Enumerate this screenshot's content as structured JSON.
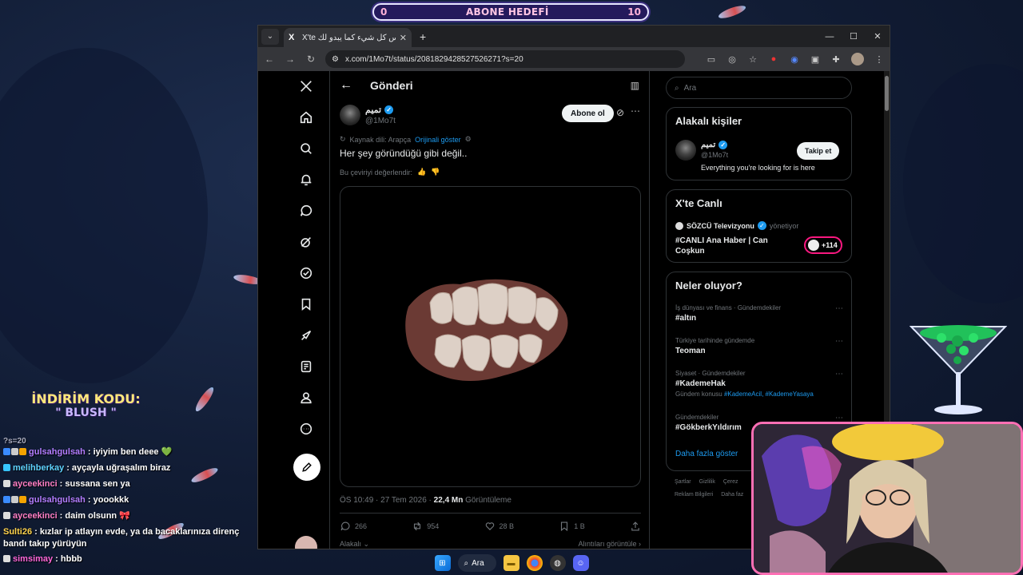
{
  "overlay": {
    "goal": {
      "start": "0",
      "title": "ABONE HEDEFİ",
      "end": "10"
    },
    "promo": {
      "line1": "İNDİRİM KODU:",
      "line2": "\" BLUSH \""
    },
    "chat_partial": "?s=20",
    "chat": [
      {
        "user": "gulsahgulsah",
        "user_color": "#b37dff",
        "message": ": iyiyim ben deee 💚",
        "badges": 3
      },
      {
        "user": "melihberkay",
        "user_color": "#5fd3ff",
        "message": ": ayçayla uğraşalım biraz",
        "badges": 1
      },
      {
        "user": "ayceekinci",
        "user_color": "#ff7fc6",
        "message": ": sussana sen ya",
        "badges": 1
      },
      {
        "user": "gulsahgulsah",
        "user_color": "#b37dff",
        "message": ": yoookkk",
        "badges": 3
      },
      {
        "user": "ayceekinci",
        "user_color": "#ff7fc6",
        "message": ": daim olsunn 🎀",
        "badges": 1
      },
      {
        "user": "Sulti26",
        "user_color": "#ffd34d",
        "message": ": kızlar ip atlayın evde, ya da bacaklarınıza direnç bandı takıp yürüyün",
        "badges": 0
      },
      {
        "user": "simsimay",
        "user_color": "#ff66d9",
        "message": ": hbbb",
        "badges": 1
      }
    ]
  },
  "browser": {
    "tab": {
      "favicon": "X",
      "title": "X'te تميم: \"ليس كل شيء كما يبدو لك\""
    },
    "url": "x.com/1Mo7t/status/2081829428527526271?s=20",
    "window_controls": [
      "minimize-icon",
      "maximize-icon",
      "close-icon"
    ]
  },
  "post": {
    "header_title": "Gönderi",
    "author_name": "تميم",
    "author_handle": "@1Mo7t",
    "subscribe_label": "Abone ol",
    "translation_source": "Kaynak dili: Arapça",
    "show_original": "Orijinali göster",
    "text": "Her şey göründüğü gibi değil..",
    "rate_translation": "Bu çeviriyi değerlendir:",
    "timestamp": "ÖS 10:49 · 27 Tem 2026 ·",
    "views_count": "22,4 Mn",
    "views_label": "Görüntüleme",
    "replies": "266",
    "reposts": "954",
    "likes": "28 B",
    "bookmarks": "1 B",
    "sort_label": "Alakalı",
    "quotes_label": "Alıntıları görüntüle"
  },
  "sidebar": {
    "search_placeholder": "Ara",
    "relevant": {
      "title": "Alakalı kişiler",
      "name": "تميم",
      "handle": "@1Mo7t",
      "bio": "Everything you're looking for is here",
      "follow_label": "Takip et"
    },
    "live": {
      "title": "X'te Canlı",
      "host": "SÖZCÜ Televizyonu",
      "host_role": "yönetiyor",
      "stream_title": "#CANLI Ana Haber | Can Coşkun",
      "listeners": "+114"
    },
    "trends": {
      "title": "Neler oluyor?",
      "items": [
        {
          "category": "İş dünyası ve finans · Gündemdekiler",
          "name": "#altın",
          "extra": ""
        },
        {
          "category": "Türkiye tarihinde gündemde",
          "name": "Teoman",
          "extra": ""
        },
        {
          "category": "Siyaset · Gündemdekiler",
          "name": "#KademeHak",
          "extra_prefix": "Gündem konusu",
          "extra_links": "#KademeAcil, #KademeYasaya"
        },
        {
          "category": "Gündemdekiler",
          "name": "#GökberkYıldırım",
          "extra": ""
        }
      ],
      "show_more": "Daha fazla göster"
    },
    "footer": [
      "Şartlar",
      "Gizlilik",
      "Çerez",
      "Reklam Bilgileri",
      "Daha faz"
    ]
  },
  "taskbar": {
    "search_label": "Ara"
  }
}
